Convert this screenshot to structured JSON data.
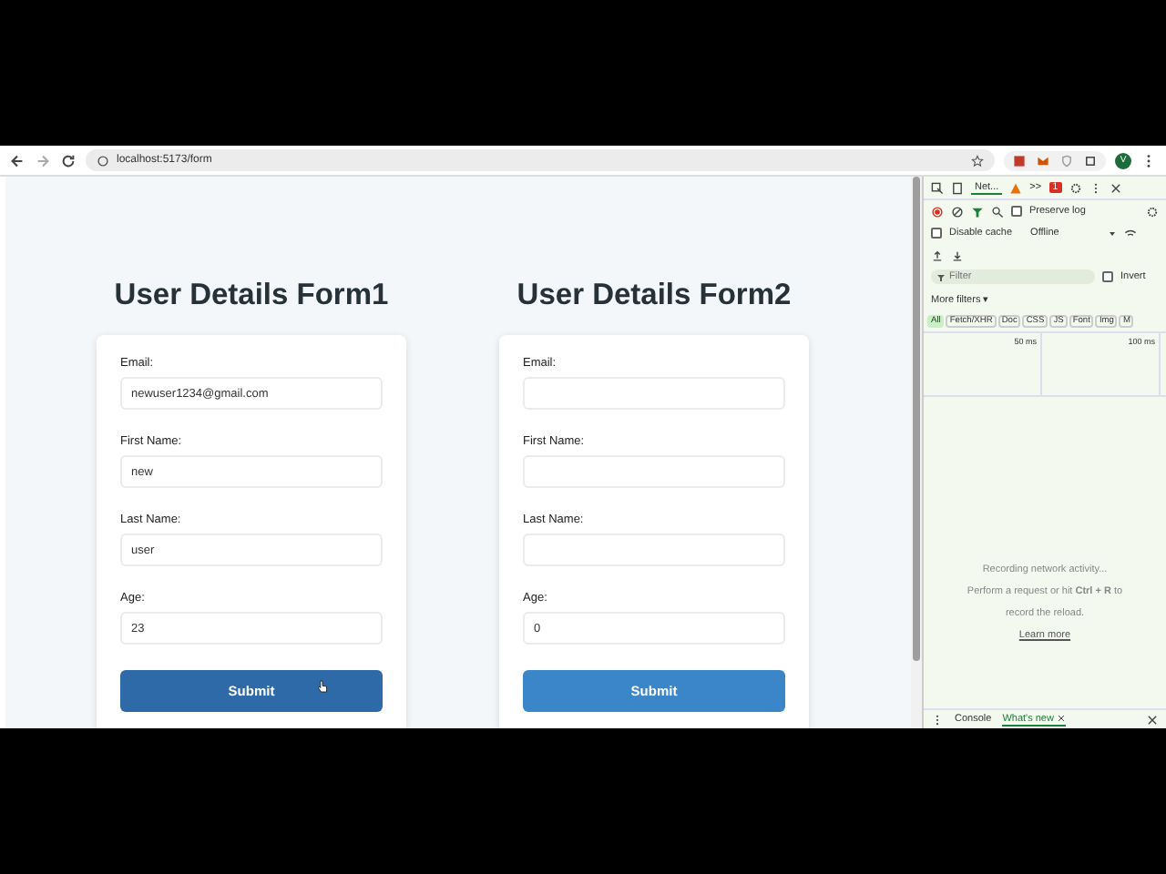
{
  "browser": {
    "url": "localhost:5173/form",
    "profile_initial": "V"
  },
  "forms": [
    {
      "title": "User Details Form1",
      "fields": [
        {
          "label": "Email:",
          "value": "newuser1234@gmail.com"
        },
        {
          "label": "First Name:",
          "value": "new"
        },
        {
          "label": "Last Name:",
          "value": "user"
        },
        {
          "label": "Age:",
          "value": "23"
        }
      ],
      "submit": "Submit",
      "hovered": true
    },
    {
      "title": "User Details Form2",
      "fields": [
        {
          "label": "Email:"
        },
        {
          "label": "First Name:"
        },
        {
          "label": "Last Name:"
        },
        {
          "label": "Age:",
          "value": "0"
        }
      ],
      "submit": "Submit",
      "hovered": false
    }
  ],
  "devtools": {
    "tabs": [
      {
        "label": "Net...",
        "selected": true
      }
    ],
    "overflow": ">>",
    "error_count": "1",
    "preserve_log": {
      "label": "Preserve log",
      "checked": false
    },
    "disable_cache": {
      "label": "Disable cache",
      "checked": false
    },
    "throttling": "Offline",
    "filter": {
      "placeholder": "Filter"
    },
    "invert": {
      "label": "Invert",
      "checked": false
    },
    "more_filters": "More filters ▾",
    "chips": [
      {
        "label": "All",
        "selected": true
      },
      {
        "label": "Fetch/XHR",
        "selected": false
      },
      {
        "label": "Doc",
        "selected": false
      },
      {
        "label": "CSS",
        "selected": false
      },
      {
        "label": "JS",
        "selected": false
      },
      {
        "label": "Font",
        "selected": false
      },
      {
        "label": "Img",
        "selected": false
      },
      {
        "label": "M",
        "selected": false
      }
    ],
    "timeline_ticks": [
      "50 ms",
      "100 ms"
    ],
    "message": [
      "Recording network activity...",
      "Perform a request or hit **Ctrl + R** to",
      "record the reload."
    ],
    "learn_more": "Learn more",
    "drawer_tabs": [
      {
        "label": "Console",
        "selected": false,
        "closable": false
      },
      {
        "label": "What's new",
        "selected": true,
        "closable": true
      }
    ]
  }
}
